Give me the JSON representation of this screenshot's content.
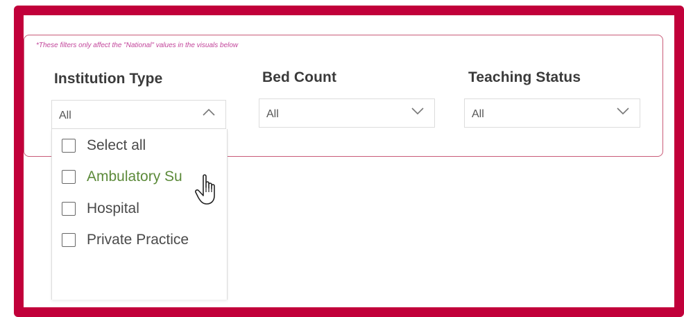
{
  "note": "*These filters only affect the \"National\" values in the visuals below",
  "filters": [
    {
      "title": "Institution Type",
      "value": "All",
      "open": true
    },
    {
      "title": "Bed Count",
      "value": "All",
      "open": false
    },
    {
      "title": "Teaching Status",
      "value": "All",
      "open": false
    }
  ],
  "institution_options": [
    "Select all",
    "Ambulatory Su",
    "Hospital",
    "Private Practice"
  ],
  "colors": {
    "frame": "#c1003a",
    "panel_border": "#c85a77",
    "note": "#c2449a",
    "hover_text": "#5c8a3a"
  },
  "icons": {
    "open_chevron": "chevron-up-icon",
    "closed_chevron": "chevron-down-icon",
    "cursor": "hand-pointer-icon"
  }
}
